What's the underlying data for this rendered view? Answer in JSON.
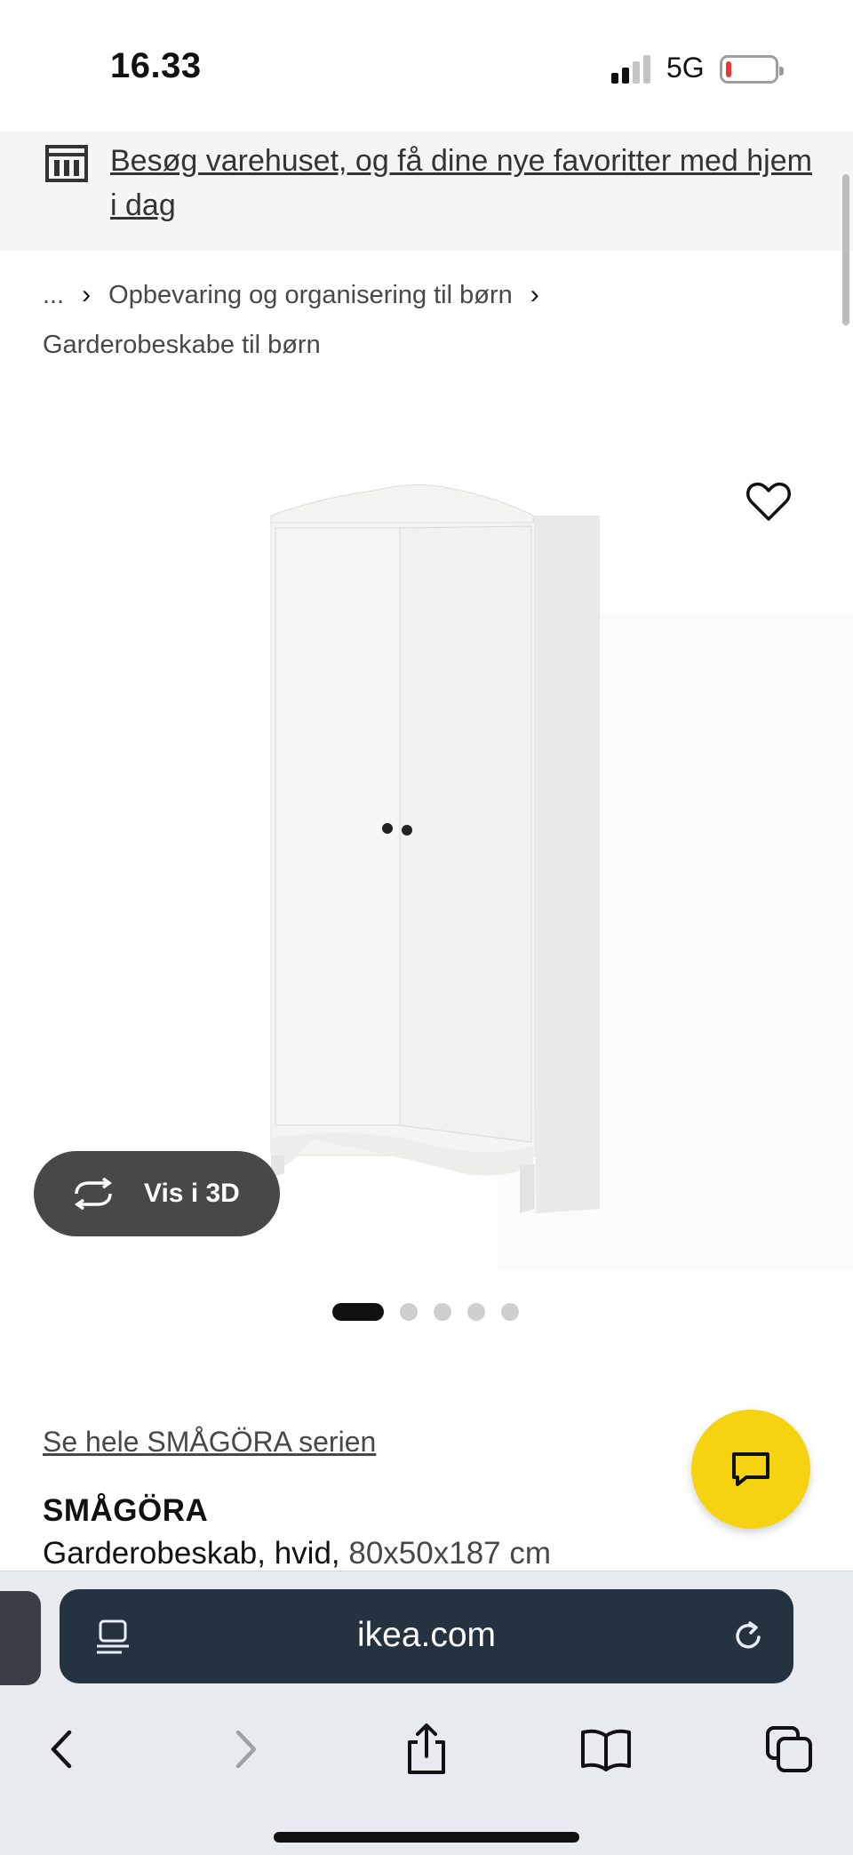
{
  "status_bar": {
    "time": "16.33",
    "network": "5G",
    "battery_level": 0.12
  },
  "store_banner": {
    "text": "Besøg varehuset, og få dine nye favoritter med hjem i dag",
    "icon": "store-icon"
  },
  "breadcrumb": {
    "ellipsis": "...",
    "items": [
      "Opbevaring og organisering til børn",
      "Garderobeskabe til børn"
    ],
    "separator": "›"
  },
  "product_gallery": {
    "view_3d_label": "Vis i 3D",
    "total_images": 5,
    "active_index": 0,
    "favorite_icon": "heart-icon"
  },
  "product": {
    "series_link": "Se hele SMÅGÖRA serien",
    "name": "SMÅGÖRA",
    "description": "Garderobeskab, hvid,",
    "dimensions": "80x50x187 cm"
  },
  "chat": {
    "icon": "chat-bubble-icon",
    "color": "#f5d311"
  },
  "browser": {
    "url": "ikea.com",
    "toolbar_icons": [
      "back-icon",
      "forward-icon",
      "share-icon",
      "bookmarks-icon",
      "tabs-icon"
    ]
  },
  "colors": {
    "banner_bg": "#f5f5f5",
    "view3d_bg": "#484848",
    "url_pill_bg": "#253341",
    "chat_fab": "#f5d311"
  }
}
